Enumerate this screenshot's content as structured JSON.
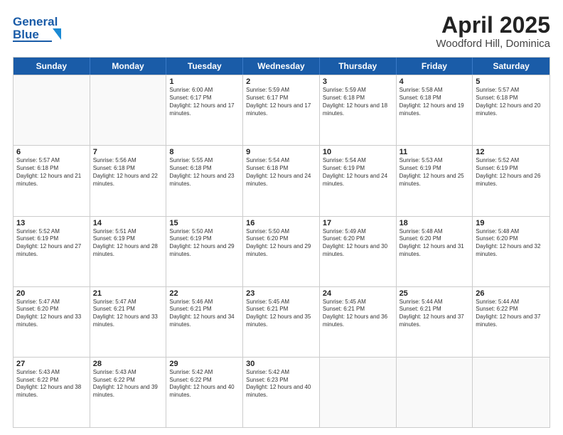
{
  "header": {
    "logo_line1": "General",
    "logo_line2": "Blue",
    "title": "April 2025",
    "subtitle": "Woodford Hill, Dominica"
  },
  "days_of_week": [
    "Sunday",
    "Monday",
    "Tuesday",
    "Wednesday",
    "Thursday",
    "Friday",
    "Saturday"
  ],
  "weeks": [
    [
      {
        "day": "",
        "sunrise": "",
        "sunset": "",
        "daylight": ""
      },
      {
        "day": "",
        "sunrise": "",
        "sunset": "",
        "daylight": ""
      },
      {
        "day": "1",
        "sunrise": "Sunrise: 6:00 AM",
        "sunset": "Sunset: 6:17 PM",
        "daylight": "Daylight: 12 hours and 17 minutes."
      },
      {
        "day": "2",
        "sunrise": "Sunrise: 5:59 AM",
        "sunset": "Sunset: 6:17 PM",
        "daylight": "Daylight: 12 hours and 17 minutes."
      },
      {
        "day": "3",
        "sunrise": "Sunrise: 5:59 AM",
        "sunset": "Sunset: 6:18 PM",
        "daylight": "Daylight: 12 hours and 18 minutes."
      },
      {
        "day": "4",
        "sunrise": "Sunrise: 5:58 AM",
        "sunset": "Sunset: 6:18 PM",
        "daylight": "Daylight: 12 hours and 19 minutes."
      },
      {
        "day": "5",
        "sunrise": "Sunrise: 5:57 AM",
        "sunset": "Sunset: 6:18 PM",
        "daylight": "Daylight: 12 hours and 20 minutes."
      }
    ],
    [
      {
        "day": "6",
        "sunrise": "Sunrise: 5:57 AM",
        "sunset": "Sunset: 6:18 PM",
        "daylight": "Daylight: 12 hours and 21 minutes."
      },
      {
        "day": "7",
        "sunrise": "Sunrise: 5:56 AM",
        "sunset": "Sunset: 6:18 PM",
        "daylight": "Daylight: 12 hours and 22 minutes."
      },
      {
        "day": "8",
        "sunrise": "Sunrise: 5:55 AM",
        "sunset": "Sunset: 6:18 PM",
        "daylight": "Daylight: 12 hours and 23 minutes."
      },
      {
        "day": "9",
        "sunrise": "Sunrise: 5:54 AM",
        "sunset": "Sunset: 6:18 PM",
        "daylight": "Daylight: 12 hours and 24 minutes."
      },
      {
        "day": "10",
        "sunrise": "Sunrise: 5:54 AM",
        "sunset": "Sunset: 6:19 PM",
        "daylight": "Daylight: 12 hours and 24 minutes."
      },
      {
        "day": "11",
        "sunrise": "Sunrise: 5:53 AM",
        "sunset": "Sunset: 6:19 PM",
        "daylight": "Daylight: 12 hours and 25 minutes."
      },
      {
        "day": "12",
        "sunrise": "Sunrise: 5:52 AM",
        "sunset": "Sunset: 6:19 PM",
        "daylight": "Daylight: 12 hours and 26 minutes."
      }
    ],
    [
      {
        "day": "13",
        "sunrise": "Sunrise: 5:52 AM",
        "sunset": "Sunset: 6:19 PM",
        "daylight": "Daylight: 12 hours and 27 minutes."
      },
      {
        "day": "14",
        "sunrise": "Sunrise: 5:51 AM",
        "sunset": "Sunset: 6:19 PM",
        "daylight": "Daylight: 12 hours and 28 minutes."
      },
      {
        "day": "15",
        "sunrise": "Sunrise: 5:50 AM",
        "sunset": "Sunset: 6:19 PM",
        "daylight": "Daylight: 12 hours and 29 minutes."
      },
      {
        "day": "16",
        "sunrise": "Sunrise: 5:50 AM",
        "sunset": "Sunset: 6:20 PM",
        "daylight": "Daylight: 12 hours and 29 minutes."
      },
      {
        "day": "17",
        "sunrise": "Sunrise: 5:49 AM",
        "sunset": "Sunset: 6:20 PM",
        "daylight": "Daylight: 12 hours and 30 minutes."
      },
      {
        "day": "18",
        "sunrise": "Sunrise: 5:48 AM",
        "sunset": "Sunset: 6:20 PM",
        "daylight": "Daylight: 12 hours and 31 minutes."
      },
      {
        "day": "19",
        "sunrise": "Sunrise: 5:48 AM",
        "sunset": "Sunset: 6:20 PM",
        "daylight": "Daylight: 12 hours and 32 minutes."
      }
    ],
    [
      {
        "day": "20",
        "sunrise": "Sunrise: 5:47 AM",
        "sunset": "Sunset: 6:20 PM",
        "daylight": "Daylight: 12 hours and 33 minutes."
      },
      {
        "day": "21",
        "sunrise": "Sunrise: 5:47 AM",
        "sunset": "Sunset: 6:21 PM",
        "daylight": "Daylight: 12 hours and 33 minutes."
      },
      {
        "day": "22",
        "sunrise": "Sunrise: 5:46 AM",
        "sunset": "Sunset: 6:21 PM",
        "daylight": "Daylight: 12 hours and 34 minutes."
      },
      {
        "day": "23",
        "sunrise": "Sunrise: 5:45 AM",
        "sunset": "Sunset: 6:21 PM",
        "daylight": "Daylight: 12 hours and 35 minutes."
      },
      {
        "day": "24",
        "sunrise": "Sunrise: 5:45 AM",
        "sunset": "Sunset: 6:21 PM",
        "daylight": "Daylight: 12 hours and 36 minutes."
      },
      {
        "day": "25",
        "sunrise": "Sunrise: 5:44 AM",
        "sunset": "Sunset: 6:21 PM",
        "daylight": "Daylight: 12 hours and 37 minutes."
      },
      {
        "day": "26",
        "sunrise": "Sunrise: 5:44 AM",
        "sunset": "Sunset: 6:22 PM",
        "daylight": "Daylight: 12 hours and 37 minutes."
      }
    ],
    [
      {
        "day": "27",
        "sunrise": "Sunrise: 5:43 AM",
        "sunset": "Sunset: 6:22 PM",
        "daylight": "Daylight: 12 hours and 38 minutes."
      },
      {
        "day": "28",
        "sunrise": "Sunrise: 5:43 AM",
        "sunset": "Sunset: 6:22 PM",
        "daylight": "Daylight: 12 hours and 39 minutes."
      },
      {
        "day": "29",
        "sunrise": "Sunrise: 5:42 AM",
        "sunset": "Sunset: 6:22 PM",
        "daylight": "Daylight: 12 hours and 40 minutes."
      },
      {
        "day": "30",
        "sunrise": "Sunrise: 5:42 AM",
        "sunset": "Sunset: 6:23 PM",
        "daylight": "Daylight: 12 hours and 40 minutes."
      },
      {
        "day": "",
        "sunrise": "",
        "sunset": "",
        "daylight": ""
      },
      {
        "day": "",
        "sunrise": "",
        "sunset": "",
        "daylight": ""
      },
      {
        "day": "",
        "sunrise": "",
        "sunset": "",
        "daylight": ""
      }
    ]
  ]
}
